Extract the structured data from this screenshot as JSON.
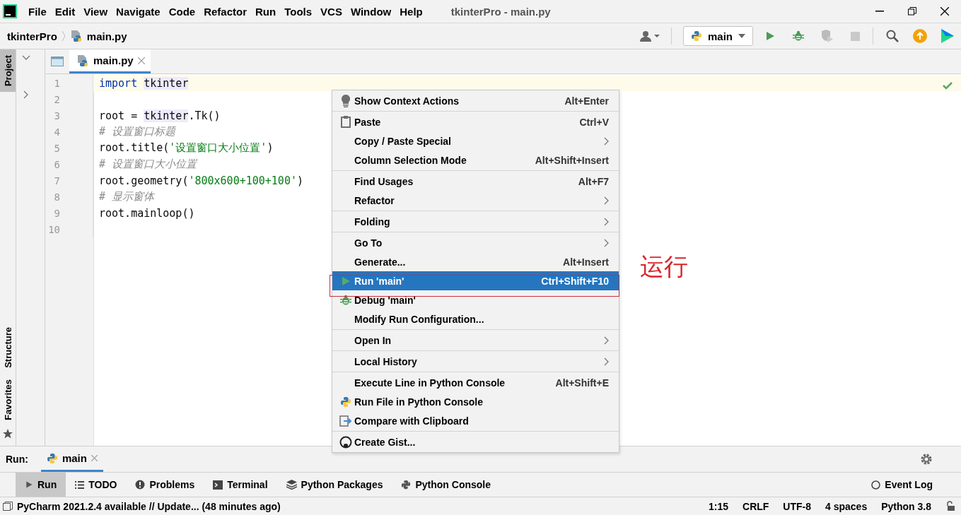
{
  "menu_bar": [
    "File",
    "Edit",
    "View",
    "Navigate",
    "Code",
    "Refactor",
    "Run",
    "Tools",
    "VCS",
    "Window",
    "Help"
  ],
  "window": {
    "title": "tkinterPro - main.py"
  },
  "breadcrumbs": [
    "tkinterPro",
    "main.py"
  ],
  "run_config": {
    "label": "main"
  },
  "side_tabs_top": [
    {
      "label": "Project",
      "selected": true
    }
  ],
  "side_tabs_bottom": [
    {
      "label": "Structure",
      "selected": false
    },
    {
      "label": "Favorites",
      "selected": false
    }
  ],
  "editor_tabs": [
    {
      "label": "main.py",
      "selected": true
    }
  ],
  "code": [
    {
      "number": "1",
      "current": true,
      "tokens": [
        {
          "kind": "keyword",
          "text": "import "
        },
        {
          "kind": "mark",
          "text": "tkinter"
        }
      ]
    },
    {
      "number": "2",
      "current": false
    },
    {
      "number": "3",
      "current": false,
      "tokens": [
        {
          "kind": "plain",
          "text": "root = "
        },
        {
          "kind": "mark",
          "text": "tkinter"
        },
        {
          "kind": "plain",
          "text": ".Tk()"
        }
      ]
    },
    {
      "number": "4",
      "current": false,
      "tokens": [
        {
          "kind": "comment",
          "text": "# 设置窗口标题"
        }
      ]
    },
    {
      "number": "5",
      "current": false,
      "tokens": [
        {
          "kind": "plain",
          "text": "root.title("
        },
        {
          "kind": "string",
          "text": "'设置窗口大小位置'"
        },
        {
          "kind": "plain",
          "text": ")"
        }
      ]
    },
    {
      "number": "6",
      "current": false,
      "tokens": [
        {
          "kind": "comment",
          "text": "# 设置窗口大小位置"
        }
      ]
    },
    {
      "number": "7",
      "current": false,
      "tokens": [
        {
          "kind": "plain",
          "text": "root.geometry("
        },
        {
          "kind": "string",
          "text": "'800x600+100+100'"
        },
        {
          "kind": "plain",
          "text": ")"
        }
      ]
    },
    {
      "number": "8",
      "current": false,
      "tokens": [
        {
          "kind": "comment",
          "text": "# 显示窗体"
        }
      ]
    },
    {
      "number": "9",
      "current": false,
      "tokens": [
        {
          "kind": "plain",
          "text": "root.mainloop()"
        }
      ]
    },
    {
      "number": "10",
      "current": false
    }
  ],
  "context_menu": [
    [
      {
        "label": "Show Context Actions",
        "shortcut": "Alt+Enter",
        "submenu": false,
        "kind": "bulb",
        "selected": false
      }
    ],
    [
      {
        "label": "Paste",
        "shortcut": "Ctrl+V",
        "submenu": false,
        "kind": "clipboard",
        "selected": false
      },
      {
        "label": "Copy / Paste Special",
        "submenu": true,
        "kind": "plain",
        "selected": false
      },
      {
        "label": "Column Selection Mode",
        "shortcut": "Alt+Shift+Insert",
        "submenu": false,
        "kind": "plain",
        "selected": false
      }
    ],
    [
      {
        "label": "Find Usages",
        "shortcut": "Alt+F7",
        "submenu": false,
        "kind": "plain",
        "selected": false
      },
      {
        "label": "Refactor",
        "submenu": true,
        "kind": "plain",
        "selected": false
      }
    ],
    [
      {
        "label": "Folding",
        "submenu": true,
        "kind": "plain",
        "selected": false
      }
    ],
    [
      {
        "label": "Go To",
        "submenu": true,
        "kind": "plain",
        "selected": false
      },
      {
        "label": "Generate...",
        "shortcut": "Alt+Insert",
        "submenu": false,
        "kind": "plain",
        "selected": false
      },
      {
        "label": "Run 'main'",
        "shortcut": "Ctrl+Shift+F10",
        "submenu": false,
        "kind": "run",
        "selected": true
      },
      {
        "label": "Debug 'main'",
        "submenu": false,
        "kind": "debug",
        "selected": false
      },
      {
        "label": "Modify Run Configuration...",
        "submenu": false,
        "kind": "plain",
        "selected": false
      }
    ],
    [
      {
        "label": "Open In",
        "submenu": true,
        "kind": "plain",
        "selected": false
      }
    ],
    [
      {
        "label": "Local History",
        "submenu": true,
        "kind": "plain",
        "selected": false
      }
    ],
    [
      {
        "label": "Execute Line in Python Console",
        "shortcut": "Alt+Shift+E",
        "submenu": false,
        "kind": "plain",
        "selected": false
      },
      {
        "label": "Run File in Python Console",
        "submenu": false,
        "kind": "python",
        "selected": false
      },
      {
        "label": "Compare with Clipboard",
        "submenu": false,
        "kind": "compare",
        "selected": false
      }
    ],
    [
      {
        "label": "Create Gist...",
        "submenu": false,
        "kind": "github",
        "selected": false
      }
    ]
  ],
  "annotation": "运行",
  "run_panel": {
    "label": "Run:",
    "tab": "main"
  },
  "tool_tabs": [
    {
      "label": "Run",
      "kind": "run",
      "selected": true
    },
    {
      "label": "TODO",
      "kind": "list",
      "selected": false
    },
    {
      "label": "Problems",
      "kind": "problems",
      "selected": false
    },
    {
      "label": "Terminal",
      "kind": "terminal",
      "selected": false
    },
    {
      "label": "Python Packages",
      "kind": "packages",
      "selected": false
    },
    {
      "label": "Python Console",
      "kind": "python",
      "selected": false
    }
  ],
  "event_log": "Event Log",
  "status_bar": {
    "message": "PyCharm 2021.2.4 available // Update... (48 minutes ago)",
    "items": [
      "1:15",
      "CRLF",
      "UTF-8",
      "4 spaces",
      "Python 3.8"
    ]
  }
}
